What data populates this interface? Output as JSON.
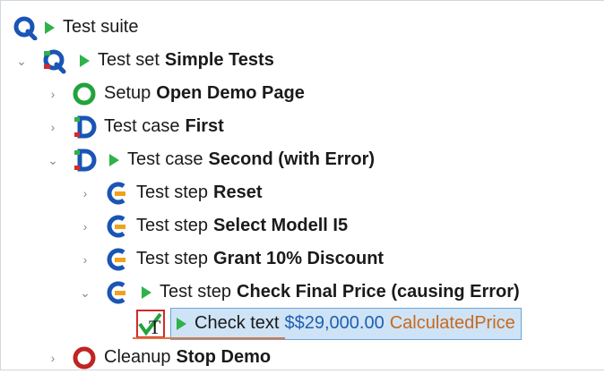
{
  "tree": {
    "root": {
      "label": "Test suite"
    },
    "test_set": {
      "prefix": "Test set",
      "name": "Simple Tests"
    },
    "setup": {
      "prefix": "Setup",
      "name": "Open Demo Page"
    },
    "case_first": {
      "prefix": "Test case",
      "name": "First"
    },
    "case_second": {
      "prefix": "Test case",
      "name": "Second (with Error)"
    },
    "step_reset": {
      "prefix": "Test step",
      "name": "Reset"
    },
    "step_select": {
      "prefix": "Test step",
      "name": "Select Modell I5"
    },
    "step_grant": {
      "prefix": "Test step",
      "name": "Grant 10% Discount"
    },
    "step_check": {
      "prefix": "Test step",
      "name": "Check Final Price (causing Error)"
    },
    "check_text": {
      "prefix": "Check text",
      "value": "$$29,000.00",
      "component": "CalculatedPrice"
    },
    "cleanup": {
      "prefix": "Cleanup",
      "name": "Stop Demo"
    }
  },
  "colors": {
    "selection_bg": "#cfe3f6",
    "selection_border": "#6aa4d6",
    "run_arrow": "#2fb24a",
    "value_blue": "#1f5fb0",
    "component_orange": "#c66a1e"
  },
  "icons": {
    "root": "qftest-suite-icon",
    "test_set": "test-set-icon",
    "setup": "setup-green-circle-icon",
    "test_case": "test-case-icon",
    "test_step": "test-step-icon",
    "check": "check-text-icon",
    "cleanup": "cleanup-red-circle-icon"
  }
}
